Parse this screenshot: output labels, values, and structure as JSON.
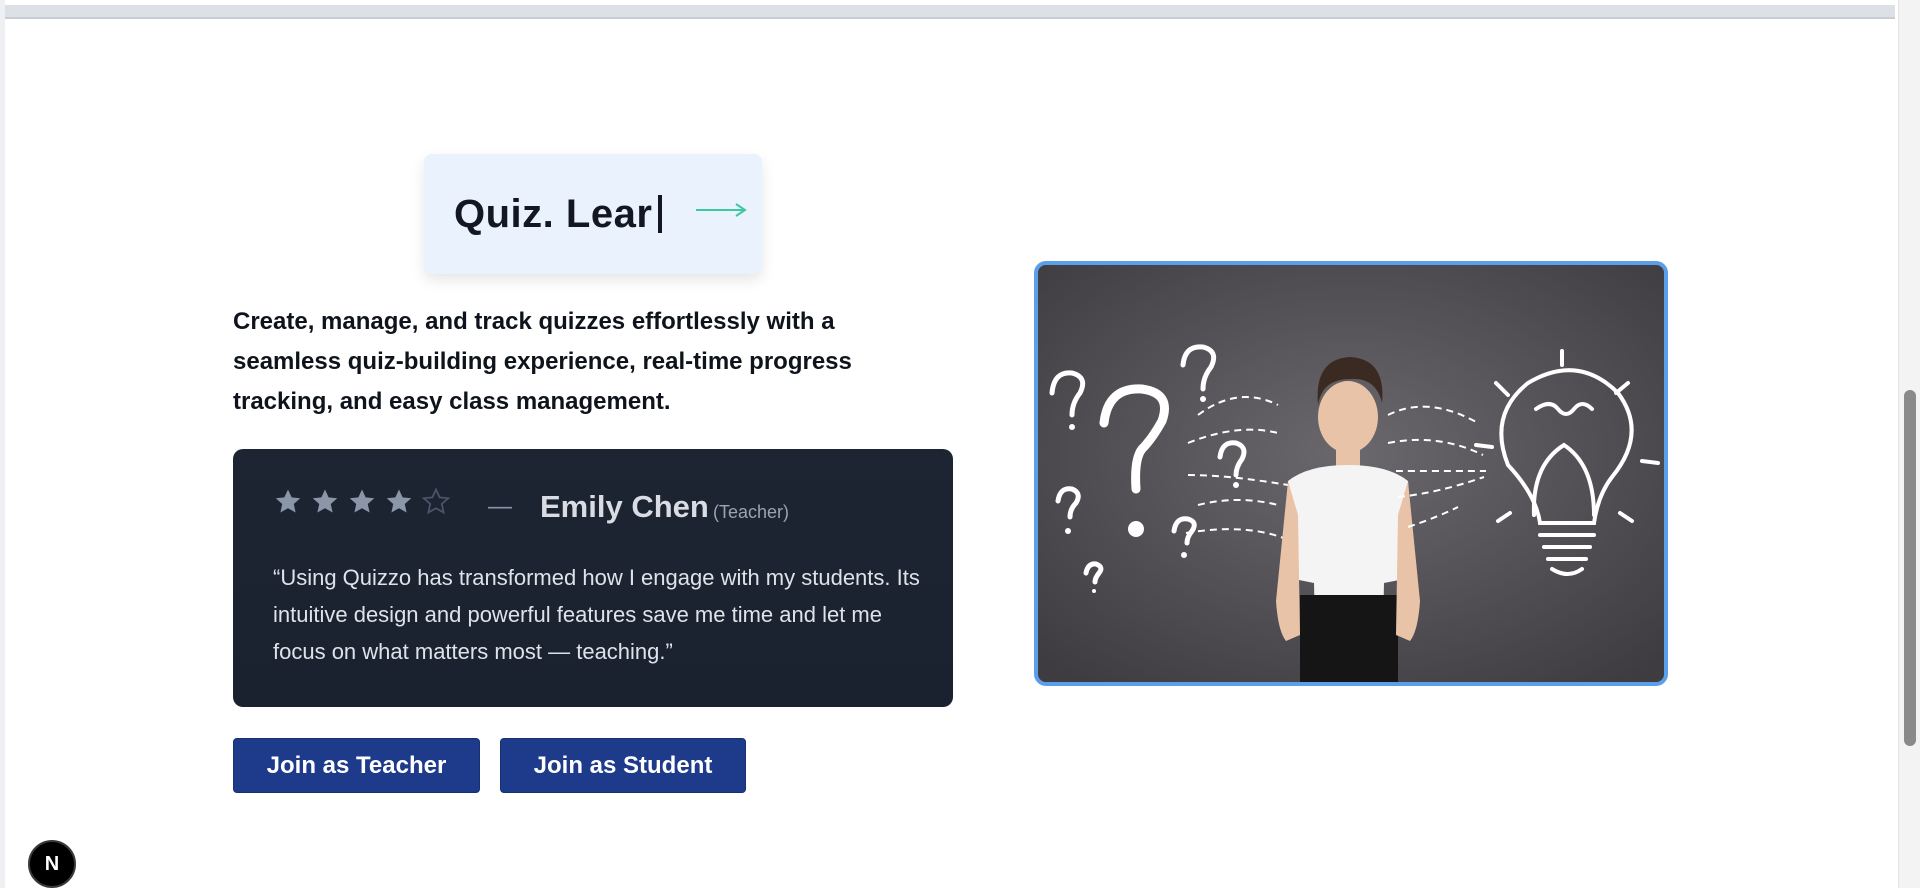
{
  "hero": {
    "typing_text": "Quiz. Lear",
    "tagline": "Create, manage, and track quizzes effortlessly with a seamless quiz-building experience, real-time progress tracking, and easy class management."
  },
  "testimonial": {
    "rating": 4,
    "rating_max": 5,
    "separator": "—",
    "author": "Emily Chen",
    "role": "(Teacher)",
    "quote": "“Using Quizzo has transformed how I engage with my students. Its intuitive design and powerful features save me time and let me focus on what matters most — teaching.”"
  },
  "buttons": {
    "teacher": "Join as Teacher",
    "student": "Join as Student"
  },
  "image": {
    "description_icon": "woman-chalkboard-lightbulb-illustration"
  },
  "dev_badge": {
    "label": "N"
  },
  "colors": {
    "button_bg": "#1e3a8a",
    "card_bg": "#1d2533",
    "heading_card_bg": "#e9f2fd",
    "image_border": "#5b9ee9",
    "arrow": "#3cc9a0"
  }
}
